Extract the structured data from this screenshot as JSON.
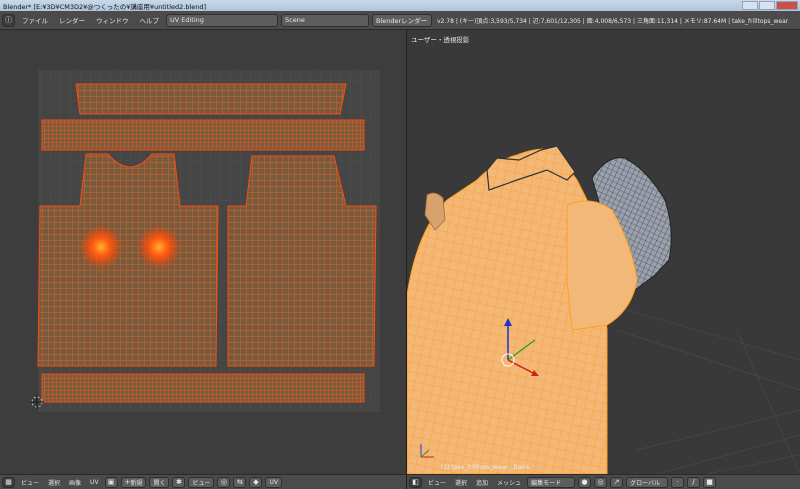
{
  "window": {
    "title": "Blender* [E:¥3D¥CM3D2¥@つくったの¥講座用¥untitled2.blend]"
  },
  "info_header": {
    "menus": [
      "ファイル",
      "レンダー",
      "ウィンドウ",
      "ヘルプ"
    ],
    "screen_layout": "UV Editing",
    "scene": "Scene",
    "render_engine": "Blenderレンダー",
    "stats": "v2.78 | (キー)頂点:3,593/5,734 | 辺:7,601/12,305 | 面:4,008/6,573 | 三角面:11,314 | メモリ:87.64M | take_frilltops_wear"
  },
  "uv_footer": {
    "menus": [
      "ビュー",
      "選択",
      "画像",
      "UV"
    ],
    "new_label": "新規",
    "open_label": "開く",
    "view_label": "ビュー",
    "uv_label": "UV"
  },
  "viewport": {
    "view_label": "ユーザー・透視投影",
    "object_label": "(1) take_frilltops_wear : Basis"
  },
  "viewport_footer": {
    "menus": [
      "ビュー",
      "選択",
      "追加",
      "メッシュ"
    ],
    "mode": "編集モード",
    "orientation": "グローバル"
  },
  "colors": {
    "header_bg": "#4b4b4b",
    "uv_grid_bg": "#444444",
    "uv_island_fill": "#7a5a3e",
    "uv_selected": "#ff4a10",
    "mesh_fill": "#f2b877",
    "mesh_wire": "#ffa020"
  },
  "icons": [
    "blender-logo-icon",
    "uv-editor-icon",
    "view3d-editor-icon",
    "pin-icon",
    "cursor-icon",
    "manipulator-icon",
    "vertex-select-icon",
    "edge-select-icon",
    "face-select-icon",
    "snap-icon"
  ]
}
